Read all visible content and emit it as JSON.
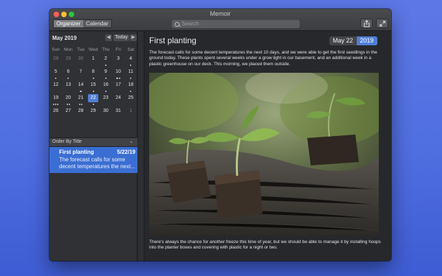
{
  "window": {
    "title": "Memoir"
  },
  "toolbar": {
    "tabs": [
      {
        "label": "Organizer",
        "active": true
      },
      {
        "label": "Calendar",
        "active": false
      }
    ],
    "search_placeholder": "Search"
  },
  "calendar": {
    "month_label": "May 2019",
    "today_label": "Today",
    "weekdays": [
      "Sun",
      "Mon",
      "Tue",
      "Wed",
      "Thu",
      "Fri",
      "Sat"
    ],
    "weeks": [
      [
        {
          "d": "28",
          "dim": true,
          "dots": 0
        },
        {
          "d": "29",
          "dim": true,
          "dots": 0
        },
        {
          "d": "30",
          "dim": true,
          "dots": 0
        },
        {
          "d": "1",
          "dots": 0
        },
        {
          "d": "2",
          "dots": 1
        },
        {
          "d": "3",
          "dots": 0
        },
        {
          "d": "4",
          "dots": 1
        }
      ],
      [
        {
          "d": "5",
          "dots": 1
        },
        {
          "d": "6",
          "dots": 1
        },
        {
          "d": "7",
          "dots": 0
        },
        {
          "d": "8",
          "dots": 1
        },
        {
          "d": "9",
          "dots": 1
        },
        {
          "d": "10",
          "dots": 2
        },
        {
          "d": "11",
          "dots": 1
        }
      ],
      [
        {
          "d": "12",
          "dots": 0
        },
        {
          "d": "13",
          "dots": 0
        },
        {
          "d": "14",
          "dots": 1
        },
        {
          "d": "15",
          "dots": 1
        },
        {
          "d": "16",
          "dots": 1
        },
        {
          "d": "17",
          "dots": 0
        },
        {
          "d": "18",
          "dots": 1
        }
      ],
      [
        {
          "d": "19",
          "dots": 3
        },
        {
          "d": "20",
          "dots": 2
        },
        {
          "d": "21",
          "dots": 2
        },
        {
          "d": "22",
          "dots": 1,
          "selected": true
        },
        {
          "d": "23",
          "dots": 0
        },
        {
          "d": "24",
          "dots": 0
        },
        {
          "d": "25",
          "dots": 0
        }
      ],
      [
        {
          "d": "26",
          "dots": 0
        },
        {
          "d": "27",
          "dots": 0
        },
        {
          "d": "28",
          "dots": 0
        },
        {
          "d": "29",
          "dots": 0
        },
        {
          "d": "30",
          "dots": 0
        },
        {
          "d": "31",
          "dots": 0
        },
        {
          "d": "1",
          "dim": true,
          "dots": 0
        }
      ]
    ]
  },
  "list": {
    "sort_label": "Order By Title",
    "entries": [
      {
        "title": "First planting",
        "date": "5/22/19",
        "preview": "The forecast calls for some decent temperatures the next..."
      }
    ]
  },
  "entry": {
    "title": "First planting",
    "badge_date": "May 22",
    "badge_year": "2019",
    "paragraph_1": "The forecast calls for some decent temperatures the next 10 days, and we were able to get the first seedlings in the ground today. These plants spent several weeks under a grow light in our basement, and an additional week in a plastic greenhouse on our deck. This morning, we placed them outside.",
    "paragraph_2": "There's always the chance for another freeze this time of year, but we should be able to manage it by installing hoops into the planter boxes and covering with plastic for a night or two."
  },
  "icons": {
    "search": "search-icon",
    "share": "share-icon",
    "expand": "fullscreen-icon",
    "photo": "seedlings-photo"
  }
}
